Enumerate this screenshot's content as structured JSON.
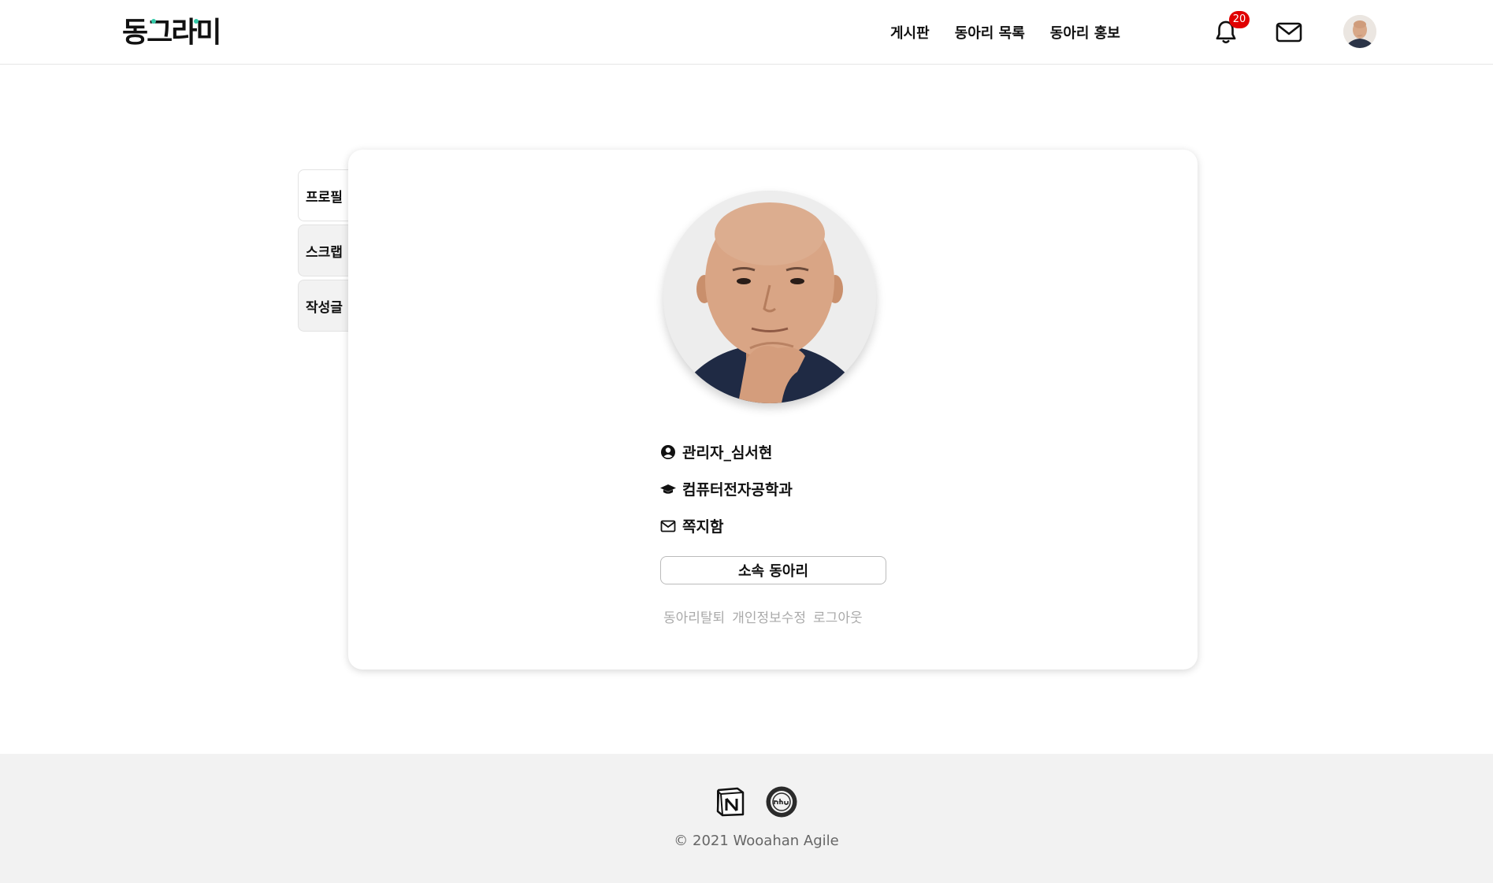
{
  "header": {
    "logo": "동그라미",
    "nav": [
      "게시판",
      "동아리 목록",
      "동아리 홍보"
    ],
    "notification_count": "20"
  },
  "side_tabs": [
    "프로필",
    "스크랩",
    "작성글"
  ],
  "profile": {
    "name": "관리자_심서현",
    "department": "컴퓨터전자공학과",
    "inbox": "쪽지함",
    "club_button": "소속 동아리",
    "actions": [
      "동아리탈퇴",
      "개인정보수정",
      "로그아웃"
    ]
  },
  "footer": {
    "copyright": "© 2021 Wooahan Agile"
  },
  "colors": {
    "badge": "#e00000",
    "logo_dot": "#33c9a8",
    "footer_bg": "#f2f2f2"
  }
}
